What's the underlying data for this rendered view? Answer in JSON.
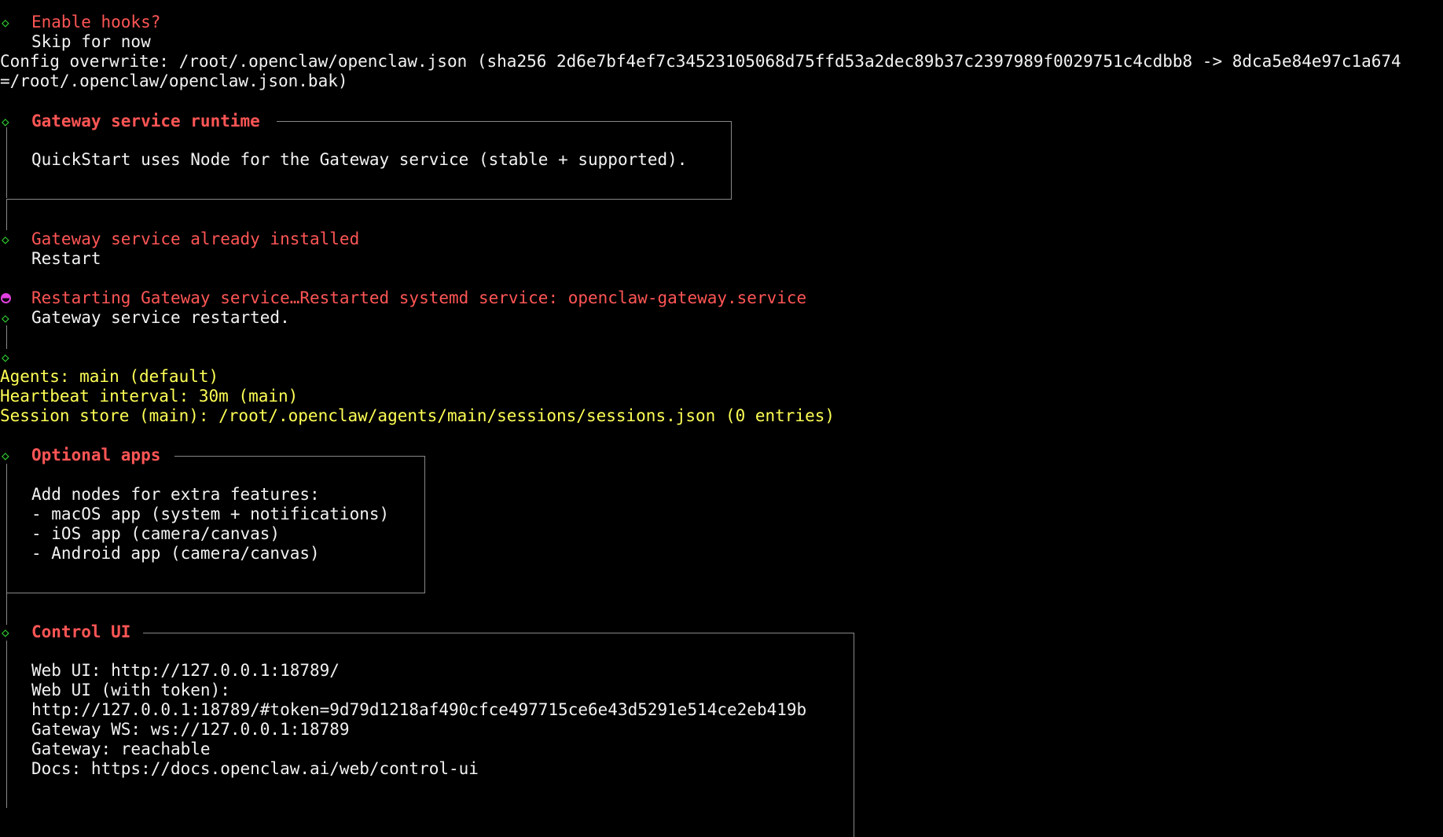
{
  "hooks": {
    "title": "Enable hooks?",
    "answer": "Skip for now"
  },
  "config": {
    "line1": "Config overwrite: /root/.openclaw/openclaw.json (sha256 2d6e7bf4ef7c34523105068d75ffd53a2dec89b37c2397989f0029751c4cdbb8 -> 8dca5e84e97c1a674",
    "line2": "=/root/.openclaw/openclaw.json.bak)"
  },
  "runtime": {
    "title": "Gateway service runtime",
    "body": "QuickStart uses Node for the Gateway service (stable + supported)."
  },
  "installed": {
    "title": "Gateway service already installed",
    "answer": "Restart"
  },
  "restart": {
    "progress": "Restarting Gateway service…Restarted systemd service: openclaw-gateway.service",
    "done": "Gateway service restarted."
  },
  "status": {
    "agents": "Agents: main (default)",
    "heartbeat": "Heartbeat interval: 30m (main)",
    "session": "Session store (main): /root/.openclaw/agents/main/sessions/sessions.json (0 entries)"
  },
  "optional_apps": {
    "title": "Optional apps",
    "lines": [
      "Add nodes for extra features:",
      "- macOS app (system + notifications)",
      "- iOS app (camera/canvas)",
      "- Android app (camera/canvas)"
    ]
  },
  "control_ui": {
    "title": "Control UI",
    "lines": [
      "Web UI: http://127.0.0.1:18789/",
      "Web UI (with token):",
      "http://127.0.0.1:18789/#token=9d79d1218af490cfce497715ce6e43d5291e514ce2eb419b",
      "Gateway WS: ws://127.0.0.1:18789",
      "Gateway: reachable",
      "Docs: https://docs.openclaw.ai/web/control-ui"
    ]
  },
  "colors": {
    "background": "#000000",
    "heading": "#ff5555",
    "text": "#f2f2f2",
    "status": "#ffff55",
    "diamond": "#33dd33",
    "spinner": "#e040e0"
  },
  "icons": {
    "step": "diamond-icon",
    "spinner": "spinner-dot-icon"
  }
}
